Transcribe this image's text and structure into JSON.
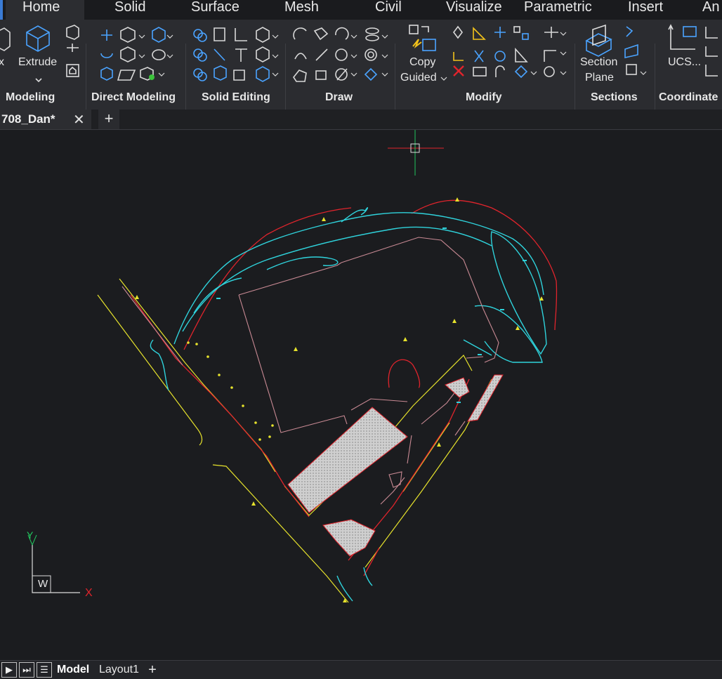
{
  "tabs": [
    "Home",
    "Solid",
    "Surface",
    "Mesh",
    "Civil",
    "Visualize",
    "Parametric",
    "Insert",
    "An"
  ],
  "panels": [
    "Modeling",
    "Direct Modeling",
    "Solid Editing",
    "Draw",
    "Modify",
    "Sections",
    "Coordinate"
  ],
  "buttons": {
    "box_partial": "x",
    "extrude": "Extrude",
    "copy": "Copy",
    "guided": "Guided",
    "section": "Section",
    "plane": "Plane",
    "ucs": "UCS..."
  },
  "document": {
    "tab_label": "708_Dan*",
    "close": "✕",
    "add": "+"
  },
  "ucs": {
    "y": "Y",
    "x": "X",
    "w": "W"
  },
  "statusbar": {
    "model": "Model",
    "layout1": "Layout1",
    "add": "+"
  },
  "colors": {
    "cyan": "#2fd3dc",
    "red": "#e0242c",
    "yellow": "#e6e22c",
    "pink": "#c98a94",
    "blue_icon": "#3e8ee8",
    "background": "#1b1c1f"
  },
  "icons": [
    "box-icon",
    "extrude-icon",
    "direct-modeling-icons",
    "solid-editing-icons",
    "draw-icons",
    "modify-icons",
    "section-plane-icon",
    "ucs-icon"
  ]
}
